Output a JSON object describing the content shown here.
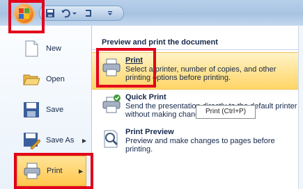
{
  "title_bar": {
    "office_button_icon": "office-logo-icon",
    "quick_access_icons": [
      "save-icon",
      "undo-icon",
      "redo-icon",
      "customize-qat-icon"
    ]
  },
  "left_menu": {
    "items": [
      {
        "label": "New",
        "icon": "new-document-icon",
        "has_arrow": false
      },
      {
        "label": "Open",
        "icon": "open-folder-icon",
        "has_arrow": false
      },
      {
        "label": "Save",
        "icon": "save-disk-icon",
        "has_arrow": false
      },
      {
        "label": "Save As",
        "icon": "save-as-icon",
        "has_arrow": true
      },
      {
        "label": "Print",
        "icon": "printer-icon",
        "has_arrow": true
      }
    ]
  },
  "right_panel": {
    "header": "Preview and print the document",
    "options": [
      {
        "title": "Print",
        "desc": "Select a printer, number of copies, and other printing options before printing.",
        "icon": "printer-icon"
      },
      {
        "title": "Quick Print",
        "desc": "Send the presentation directly to the default printer without making changes.",
        "icon": "quick-print-icon"
      },
      {
        "title": "Print Preview",
        "desc": "Preview and make changes to pages before printing.",
        "icon": "magnifier-page-icon"
      }
    ]
  },
  "tooltip": "Print (Ctrl+P)",
  "colors": {
    "annotation_red": "#e2001a",
    "highlight": "#ffd566",
    "text": "#15284b"
  }
}
